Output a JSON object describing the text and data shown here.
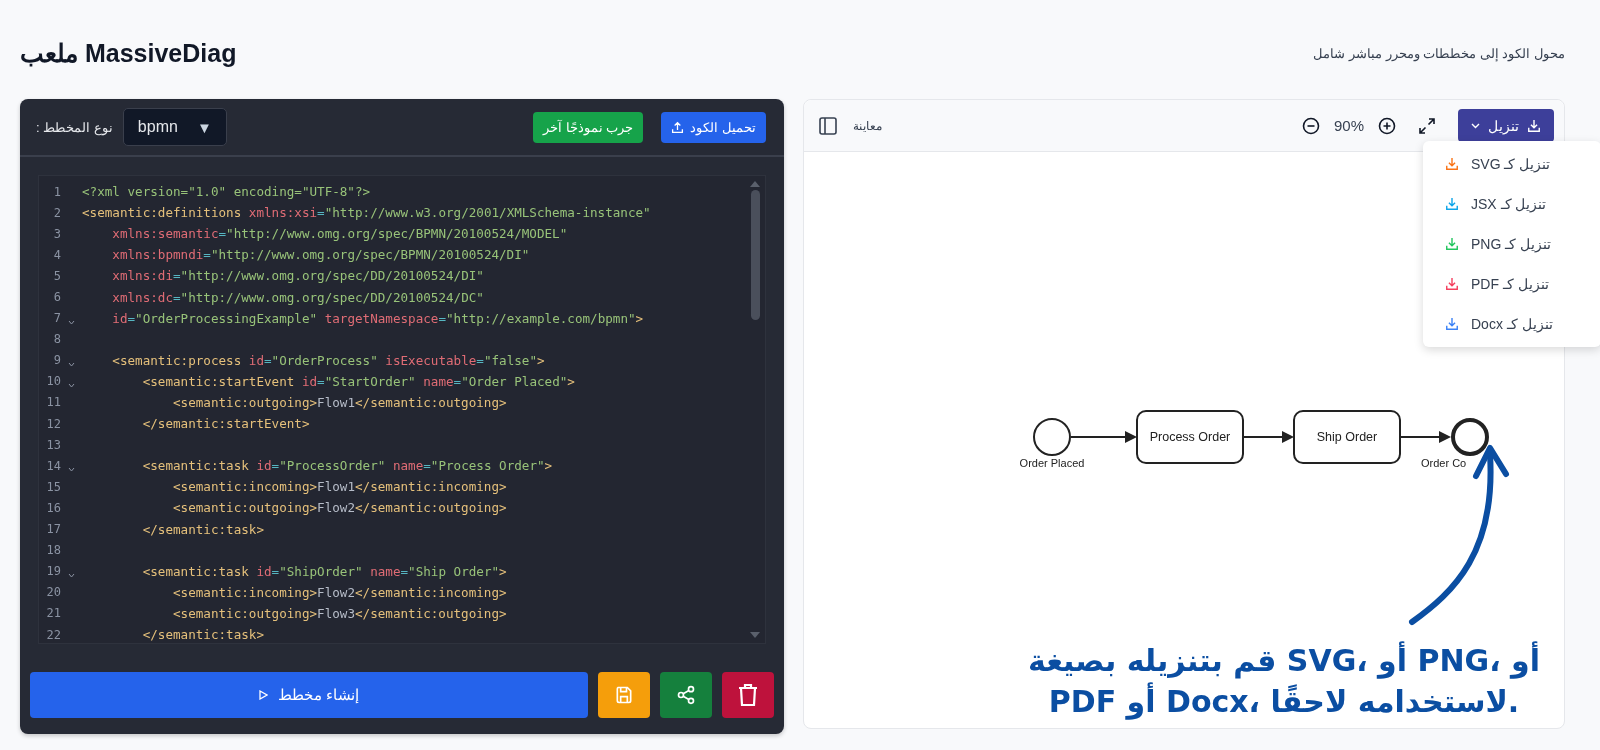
{
  "header": {
    "title": "ملعب MassiveDiag",
    "subtitle": "محول الكود إلى مخططات ومحرر مباشر شامل"
  },
  "editor_panel": {
    "type_label": "نوع المخطط :",
    "type_value": "bpmn",
    "type_caret": "▼",
    "buttons": [
      {
        "label": "تحميل الكود",
        "kind": "upload"
      },
      {
        "label": "جرب نموذجًا آخر",
        "kind": "sample"
      }
    ],
    "lines": [
      {
        "number": "1",
        "foldable": false,
        "tokens": [
          {
            "kind": "str",
            "text": "<?xml version=\"1.0\" encoding=\"UTF-8\"?>"
          }
        ]
      },
      {
        "number": "2",
        "foldable": false,
        "tokens": [
          {
            "kind": "tag",
            "text": "<semantic:definitions"
          },
          {
            "kind": "attr",
            "text": " xmlns:xsi"
          },
          {
            "kind": "eq",
            "text": "="
          },
          {
            "kind": "str",
            "text": "\"http://www.w3.org/2001/XMLSchema-instance\""
          }
        ]
      },
      {
        "number": "3",
        "foldable": false,
        "tokens": [
          {
            "kind": "attr",
            "text": "    xmlns:semantic"
          },
          {
            "kind": "eq",
            "text": "="
          },
          {
            "kind": "str",
            "text": "\"http://www.omg.org/spec/BPMN/20100524/MODEL\""
          }
        ]
      },
      {
        "number": "4",
        "foldable": false,
        "tokens": [
          {
            "kind": "attr",
            "text": "    xmlns:bpmndi"
          },
          {
            "kind": "eq",
            "text": "="
          },
          {
            "kind": "str",
            "text": "\"http://www.omg.org/spec/BPMN/20100524/DI\""
          }
        ]
      },
      {
        "number": "5",
        "foldable": false,
        "tokens": [
          {
            "kind": "attr",
            "text": "    xmlns:di"
          },
          {
            "kind": "eq",
            "text": "="
          },
          {
            "kind": "str",
            "text": "\"http://www.omg.org/spec/DD/20100524/DI\""
          }
        ]
      },
      {
        "number": "6",
        "foldable": false,
        "tokens": [
          {
            "kind": "attr",
            "text": "    xmlns:dc"
          },
          {
            "kind": "eq",
            "text": "="
          },
          {
            "kind": "str",
            "text": "\"http://www.omg.org/spec/DD/20100524/DC\""
          }
        ]
      },
      {
        "number": "7",
        "foldable": true,
        "tokens": [
          {
            "kind": "attr",
            "text": "    id"
          },
          {
            "kind": "eq",
            "text": "="
          },
          {
            "kind": "str",
            "text": "\"OrderProcessingExample\""
          },
          {
            "kind": "attr",
            "text": " targetNamespace"
          },
          {
            "kind": "eq",
            "text": "="
          },
          {
            "kind": "str",
            "text": "\"http://example.com/bpmn\""
          },
          {
            "kind": "tag",
            "text": ">"
          }
        ]
      },
      {
        "number": "8",
        "foldable": false
      },
      {
        "number": "9",
        "foldable": true,
        "tokens": [
          {
            "kind": "tag",
            "text": "    <semantic:process"
          },
          {
            "kind": "attr",
            "text": " id"
          },
          {
            "kind": "eq",
            "text": "="
          },
          {
            "kind": "str",
            "text": "\"OrderProcess\""
          },
          {
            "kind": "attr",
            "text": " isExecutable"
          },
          {
            "kind": "eq",
            "text": "="
          },
          {
            "kind": "str",
            "text": "\"false\""
          },
          {
            "kind": "tag",
            "text": ">"
          }
        ]
      },
      {
        "number": "10",
        "foldable": true,
        "tokens": [
          {
            "kind": "tag",
            "text": "        <semantic:startEvent"
          },
          {
            "kind": "attr",
            "text": " id"
          },
          {
            "kind": "eq",
            "text": "="
          },
          {
            "kind": "str",
            "text": "\"StartOrder\""
          },
          {
            "kind": "attr",
            "text": " name"
          },
          {
            "kind": "eq",
            "text": "="
          },
          {
            "kind": "str",
            "text": "\"Order Placed\""
          },
          {
            "kind": "tag",
            "text": ">"
          }
        ]
      },
      {
        "number": "11",
        "foldable": false,
        "tokens": [
          {
            "kind": "tag",
            "text": "            <semantic:outgoing>"
          },
          {
            "kind": "text",
            "text": "Flow1"
          },
          {
            "kind": "tag",
            "text": "</semantic:outgoing>"
          }
        ]
      },
      {
        "number": "12",
        "foldable": false,
        "tokens": [
          {
            "kind": "tag",
            "text": "        </semantic:startEvent>"
          }
        ]
      },
      {
        "number": "13",
        "foldable": false
      },
      {
        "number": "14",
        "foldable": true,
        "tokens": [
          {
            "kind": "tag",
            "text": "        <semantic:task"
          },
          {
            "kind": "attr",
            "text": " id"
          },
          {
            "kind": "eq",
            "text": "="
          },
          {
            "kind": "str",
            "text": "\"ProcessOrder\""
          },
          {
            "kind": "attr",
            "text": " name"
          },
          {
            "kind": "eq",
            "text": "="
          },
          {
            "kind": "str",
            "text": "\"Process Order\""
          },
          {
            "kind": "tag",
            "text": ">"
          }
        ]
      },
      {
        "number": "15",
        "foldable": false,
        "tokens": [
          {
            "kind": "tag",
            "text": "            <semantic:incoming>"
          },
          {
            "kind": "text",
            "text": "Flow1"
          },
          {
            "kind": "tag",
            "text": "</semantic:incoming>"
          }
        ]
      },
      {
        "number": "16",
        "foldable": false,
        "tokens": [
          {
            "kind": "tag",
            "text": "            <semantic:outgoing>"
          },
          {
            "kind": "text",
            "text": "Flow2"
          },
          {
            "kind": "tag",
            "text": "</semantic:outgoing>"
          }
        ]
      },
      {
        "number": "17",
        "foldable": false,
        "tokens": [
          {
            "kind": "tag",
            "text": "        </semantic:task>"
          }
        ]
      },
      {
        "number": "18",
        "foldable": false
      },
      {
        "number": "19",
        "foldable": true,
        "tokens": [
          {
            "kind": "tag",
            "text": "        <semantic:task"
          },
          {
            "kind": "attr",
            "text": " id"
          },
          {
            "kind": "eq",
            "text": "="
          },
          {
            "kind": "str",
            "text": "\"ShipOrder\""
          },
          {
            "kind": "attr",
            "text": " name"
          },
          {
            "kind": "eq",
            "text": "="
          },
          {
            "kind": "str",
            "text": "\"Ship Order\""
          },
          {
            "kind": "tag",
            "text": ">"
          }
        ]
      },
      {
        "number": "20",
        "foldable": false,
        "tokens": [
          {
            "kind": "tag",
            "text": "            <semantic:incoming>"
          },
          {
            "kind": "text",
            "text": "Flow2"
          },
          {
            "kind": "tag",
            "text": "</semantic:incoming>"
          }
        ]
      },
      {
        "number": "21",
        "foldable": false,
        "tokens": [
          {
            "kind": "tag",
            "text": "            <semantic:outgoing>"
          },
          {
            "kind": "text",
            "text": "Flow3"
          },
          {
            "kind": "tag",
            "text": "</semantic:outgoing>"
          }
        ]
      },
      {
        "number": "22",
        "foldable": false,
        "tokens": [
          {
            "kind": "tag",
            "text": "        </semantic:task>"
          }
        ]
      }
    ],
    "generate_label": "إنشاء مخطط"
  },
  "preview_panel": {
    "label": "معاينة",
    "zoom": "90%",
    "download_label": "تنزيل",
    "menu": [
      {
        "label": "تنزيل كـ SVG",
        "color": "#f97316"
      },
      {
        "label": "تنزيل كـ JSX",
        "color": "#0ea5e9"
      },
      {
        "label": "تنزيل كـ PNG",
        "color": "#22c55e"
      },
      {
        "label": "تنزيل كـ PDF",
        "color": "#f43f5e"
      },
      {
        "label": "تنزيل كـ Docx",
        "color": "#3b82f6"
      }
    ],
    "diagram": {
      "nodes": [
        {
          "kind": "start",
          "label": "Order Placed"
        },
        {
          "kind": "task",
          "label": "Process Order"
        },
        {
          "kind": "task",
          "label": "Ship Order"
        },
        {
          "kind": "end",
          "label": "Order Co"
        }
      ]
    },
    "annotation": "قم بتنزيله بصيغة SVG، أو PNG، أو PDF أو Docx، لاستخدامه لاحقًا."
  }
}
